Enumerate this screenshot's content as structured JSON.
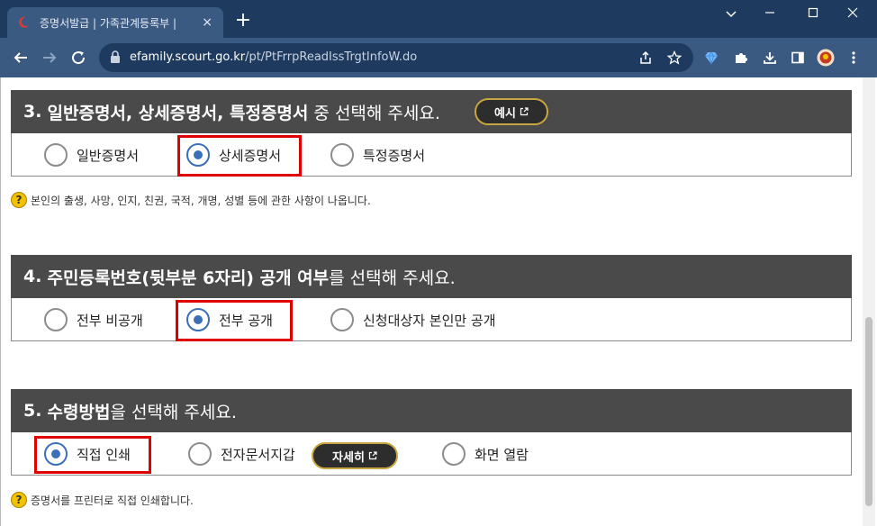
{
  "browser": {
    "tab_title": "증명서발급 | 가족관계등록부 | ",
    "tab_close": "×",
    "new_tab": "+",
    "url_host": "efamily.scourt.go.kr",
    "url_path": "/pt/PtFrrpReadIssTrgtInfoW.do",
    "colors": {
      "titlebar": "#1e3a5f",
      "toolbar": "#3b5a82"
    }
  },
  "sections": [
    {
      "number": "3.",
      "title_bold": "일반증명서, 상세증명서, 특정증명서",
      "title_rest": "중 선택해 주세요.",
      "button_label": "예시",
      "options": [
        "일반증명서",
        "상세증명서",
        "특정증명서"
      ],
      "selected": "상세증명서",
      "help": "본인의 출생, 사망, 인지, 친권, 국적, 개명, 성별 등에 관한 사항이 나옵니다."
    },
    {
      "number": "4.",
      "title_bold": "주민등록번호(뒷부분 6자리) 공개 여부",
      "title_rest": "를 선택해 주세요.",
      "options": [
        "전부 비공개",
        "전부 공개",
        "신청대상자 본인만 공개"
      ],
      "selected": "전부 공개"
    },
    {
      "number": "5.",
      "title_bold": "수령방법",
      "title_rest": "을 선택해 주세요.",
      "options": [
        "직접 인쇄",
        "전자문서지갑",
        "화면 열람"
      ],
      "selected": "직접 인쇄",
      "button_label": "자세히",
      "help": "증명서를 프린터로 직접 인쇄합니다."
    }
  ],
  "help_icon_glyph": "?",
  "accent_color": "#3c6fb8",
  "highlight_color": "#e00000"
}
